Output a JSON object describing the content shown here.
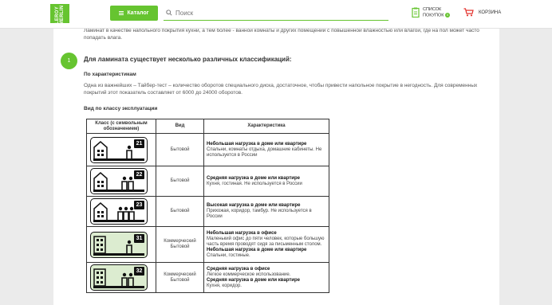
{
  "header": {
    "logo_text": "LEROY MERLIN",
    "catalog_label": "Каталог",
    "search_placeholder": "Поиск",
    "shoplist_line1": "СПИСОК",
    "shoplist_line2": "ПОКУПОК",
    "shoplist_count": "0",
    "cart_label": "КОРЗИНА"
  },
  "article": {
    "intro": "Ламинат в качестве напольного покрытия кухни, а тем более - ванной комнаты и других помещений с повышенной влажностью или влагой, где на пол может часто попадать влага.",
    "step_number": "1",
    "step_title": "Для ламината существует несколько различных классификаций:",
    "sub_characteristics": "По характеристикам",
    "paragraph": "Одна из важнейших – Тайбер-тест – количество оборотов специального диска, достаточное, чтобы привести напольное покрытие в негодность. Для современных покрытий этот показатель составляет от 6000 до 24000 оборотов.",
    "sub_class": "Вид по классу эксплуатации"
  },
  "table": {
    "headers": [
      "Класс (с символьным обозначением)",
      "Вид",
      "Характеристика"
    ],
    "rows": [
      {
        "num": "21",
        "kind": "Бытовой",
        "title": "Небольшая нагрузка в доме или квартире",
        "text": "Спальни, комнаты отдыха, домашние кабинеты. Не используется в России",
        "title2": "",
        "text2": ""
      },
      {
        "num": "22",
        "kind": "Бытовой",
        "title": "Средняя нагрузка в доме или квартире",
        "text": "Кухня, гостиная. Не используется в России",
        "title2": "",
        "text2": ""
      },
      {
        "num": "23",
        "kind": "Бытовой",
        "title": "Высокая нагрузка в доме или квартире",
        "text": "Прихожая, коридор, тамбур. Не используется в России",
        "title2": "",
        "text2": ""
      },
      {
        "num": "31",
        "kind": "Коммерческий Бытовой",
        "title": "Небольшая нагрузка в офисе",
        "text": "Маленький офис до пяти человек, которые большую часть время проводят сидя за письменным столом.",
        "title2": "Небольшая нагрузка в доме или квартире",
        "text2": "Спальни, гостиные."
      },
      {
        "num": "32",
        "kind": "Коммерческий Бытовой",
        "title": "Средняя нагрузка в офисе",
        "text": "Легкое коммерческое использование.",
        "title2": "Средняя нагрузка в доме или квартире",
        "text2": "Кухня, коридор."
      }
    ]
  },
  "colors": {
    "brand": "#66c430",
    "commercial_bg": "#dcecd0"
  }
}
